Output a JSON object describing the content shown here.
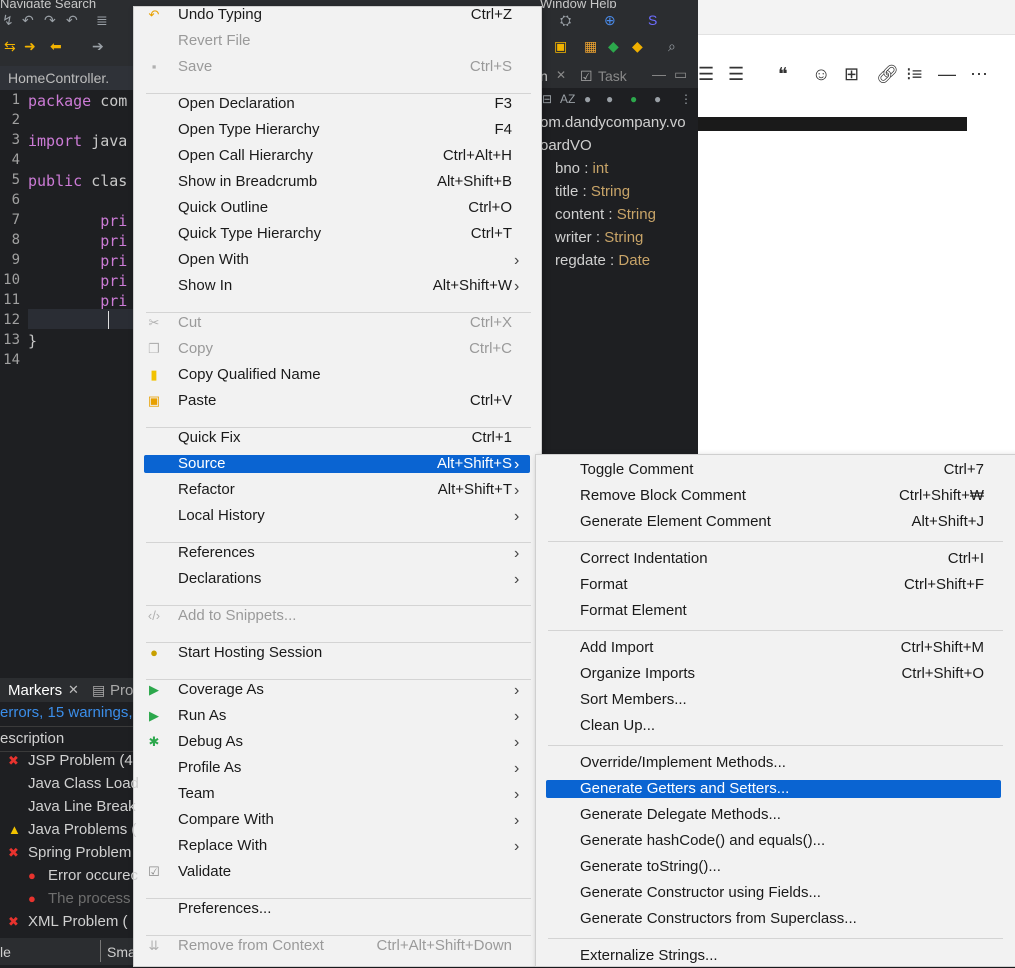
{
  "ide": {
    "menu_strip_left": "Navigate  Search",
    "menu_strip_right": "Window  Help",
    "editor_tab": "HomeController.",
    "code_lines": [
      {
        "num": "1",
        "text": "package com"
      },
      {
        "num": "2",
        "text": ""
      },
      {
        "num": "3",
        "text": "import java"
      },
      {
        "num": "4",
        "text": ""
      },
      {
        "num": "5",
        "text": "public clas"
      },
      {
        "num": "6",
        "text": ""
      },
      {
        "num": "7",
        "text": "        pri"
      },
      {
        "num": "8",
        "text": "        pri"
      },
      {
        "num": "9",
        "text": "        pri"
      },
      {
        "num": "10",
        "text": "        pri"
      },
      {
        "num": "11",
        "text": "        pri"
      },
      {
        "num": "12",
        "text": "        "
      },
      {
        "num": "13",
        "text": "}"
      },
      {
        "num": "14",
        "text": ""
      }
    ],
    "outline": {
      "tab1": "n",
      "tab2": "Task",
      "package": "om.dandycompany.vo",
      "class": "oardVO",
      "fields": [
        {
          "name": "bno",
          "type": "int"
        },
        {
          "name": "title",
          "type": "String"
        },
        {
          "name": "content",
          "type": "String"
        },
        {
          "name": "writer",
          "type": "String"
        },
        {
          "name": "regdate",
          "type": "Date"
        }
      ]
    },
    "markers": {
      "tab1": "Markers",
      "tab2": "Pro",
      "summary": "errors, 15 warnings,",
      "header": "escription",
      "rows": [
        {
          "text": "JSP Problem (4",
          "icon": "error"
        },
        {
          "text": "Java Class Load",
          "icon": "none"
        },
        {
          "text": "Java Line Break",
          "icon": "none"
        },
        {
          "text": "Java Problems (",
          "icon": "warning"
        },
        {
          "text": "Spring Problem",
          "icon": "error"
        },
        {
          "text": "Error occurec",
          "icon": "bulb"
        },
        {
          "text": "The process",
          "icon": "bulb"
        },
        {
          "text": "XML Problem (",
          "icon": "error"
        }
      ],
      "status_left": "le",
      "status_right": "Sma"
    }
  },
  "main_menu": [
    {
      "label": "Undo Typing",
      "shortcut": "Ctrl+Z",
      "enabled": true,
      "icon": "undo-icon"
    },
    {
      "label": "Revert File",
      "shortcut": "",
      "enabled": false
    },
    {
      "label": "Save",
      "shortcut": "Ctrl+S",
      "enabled": false,
      "icon": "save-icon"
    },
    {
      "label": "Open Declaration",
      "shortcut": "F3",
      "enabled": true
    },
    {
      "label": "Open Type Hierarchy",
      "shortcut": "F4",
      "enabled": true
    },
    {
      "label": "Open Call Hierarchy",
      "shortcut": "Ctrl+Alt+H",
      "enabled": true
    },
    {
      "label": "Show in Breadcrumb",
      "shortcut": "Alt+Shift+B",
      "enabled": true
    },
    {
      "label": "Quick Outline",
      "shortcut": "Ctrl+O",
      "enabled": true
    },
    {
      "label": "Quick Type Hierarchy",
      "shortcut": "Ctrl+T",
      "enabled": true
    },
    {
      "label": "Open With",
      "shortcut": "",
      "enabled": true,
      "submenu": true
    },
    {
      "label": "Show In",
      "shortcut": "Alt+Shift+W",
      "enabled": true,
      "submenu": true
    },
    {
      "label": "Cut",
      "shortcut": "Ctrl+X",
      "enabled": false,
      "icon": "cut-icon"
    },
    {
      "label": "Copy",
      "shortcut": "Ctrl+C",
      "enabled": false,
      "icon": "copy-icon"
    },
    {
      "label": "Copy Qualified Name",
      "shortcut": "",
      "enabled": true,
      "icon": "copy-qualified-icon"
    },
    {
      "label": "Paste",
      "shortcut": "Ctrl+V",
      "enabled": true,
      "icon": "paste-icon"
    },
    {
      "label": "Quick Fix",
      "shortcut": "Ctrl+1",
      "enabled": true
    },
    {
      "label": "Source",
      "shortcut": "Alt+Shift+S",
      "enabled": true,
      "submenu": true,
      "highlighted": true
    },
    {
      "label": "Refactor",
      "shortcut": "Alt+Shift+T",
      "enabled": true,
      "submenu": true
    },
    {
      "label": "Local History",
      "shortcut": "",
      "enabled": true,
      "submenu": true
    },
    {
      "label": "References",
      "shortcut": "",
      "enabled": true,
      "submenu": true
    },
    {
      "label": "Declarations",
      "shortcut": "",
      "enabled": true,
      "submenu": true
    },
    {
      "label": "Add to Snippets...",
      "shortcut": "",
      "enabled": false,
      "icon": "snippet-icon"
    },
    {
      "label": "Start Hosting Session",
      "shortcut": "",
      "enabled": true,
      "icon": "hosting-icon"
    },
    {
      "label": "Coverage As",
      "shortcut": "",
      "enabled": true,
      "submenu": true,
      "icon": "coverage-icon"
    },
    {
      "label": "Run As",
      "shortcut": "",
      "enabled": true,
      "submenu": true,
      "icon": "run-icon"
    },
    {
      "label": "Debug As",
      "shortcut": "",
      "enabled": true,
      "submenu": true,
      "icon": "debug-icon"
    },
    {
      "label": "Profile As",
      "shortcut": "",
      "enabled": true,
      "submenu": true
    },
    {
      "label": "Team",
      "shortcut": "",
      "enabled": true,
      "submenu": true
    },
    {
      "label": "Compare With",
      "shortcut": "",
      "enabled": true,
      "submenu": true
    },
    {
      "label": "Replace With",
      "shortcut": "",
      "enabled": true,
      "submenu": true
    },
    {
      "label": "Validate",
      "shortcut": "",
      "enabled": true,
      "icon": "validate-icon"
    },
    {
      "label": "Preferences...",
      "shortcut": "",
      "enabled": true
    },
    {
      "label": "Remove from Context",
      "shortcut": "Ctrl+Alt+Shift+Down",
      "enabled": false,
      "icon": "remove-context-icon"
    }
  ],
  "source_submenu": [
    {
      "label": "Toggle Comment",
      "shortcut": "Ctrl+7"
    },
    {
      "label": "Remove Block Comment",
      "shortcut": "Ctrl+Shift+₩"
    },
    {
      "label": "Generate Element Comment",
      "shortcut": "Alt+Shift+J"
    },
    {
      "label": "Correct Indentation",
      "shortcut": "Ctrl+I"
    },
    {
      "label": "Format",
      "shortcut": "Ctrl+Shift+F"
    },
    {
      "label": "Format Element",
      "shortcut": ""
    },
    {
      "label": "Add Import",
      "shortcut": "Ctrl+Shift+M"
    },
    {
      "label": "Organize Imports",
      "shortcut": "Ctrl+Shift+O"
    },
    {
      "label": "Sort Members...",
      "shortcut": ""
    },
    {
      "label": "Clean Up...",
      "shortcut": ""
    },
    {
      "label": "Override/Implement Methods...",
      "shortcut": ""
    },
    {
      "label": "Generate Getters and Setters...",
      "shortcut": "",
      "highlighted": true
    },
    {
      "label": "Generate Delegate Methods...",
      "shortcut": ""
    },
    {
      "label": "Generate hashCode() and equals()...",
      "shortcut": ""
    },
    {
      "label": "Generate toString()...",
      "shortcut": ""
    },
    {
      "label": "Generate Constructor using Fields...",
      "shortcut": ""
    },
    {
      "label": "Generate Constructors from Superclass...",
      "shortcut": ""
    },
    {
      "label": "Externalize Strings...",
      "shortcut": ""
    }
  ],
  "colors": {
    "highlight": "#0a64d2",
    "menu_bg": "#f2f2f2",
    "ide_bg": "#1e1f22"
  }
}
